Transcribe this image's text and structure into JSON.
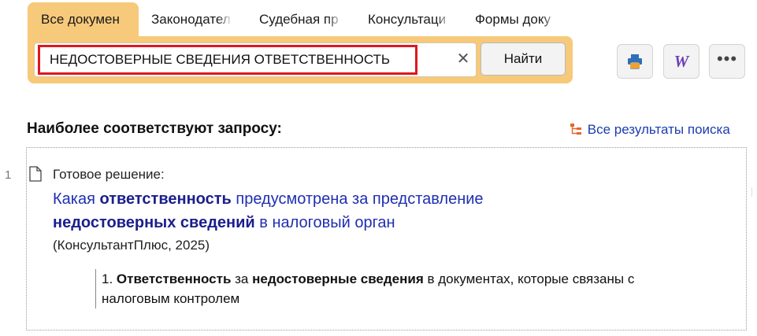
{
  "tabs": [
    {
      "label": "Все докумен",
      "active": true
    },
    {
      "label": "Законодател",
      "active": false
    },
    {
      "label": "Судебная пр",
      "active": false
    },
    {
      "label": "Консультаци",
      "active": false
    },
    {
      "label": "Формы доку",
      "active": false
    }
  ],
  "search": {
    "value": "НЕДОСТОВЕРНЫЕ СВЕДЕНИЯ ОТВЕТСТВЕННОСТЬ",
    "clear_icon": "close-icon",
    "find_label": "Найти"
  },
  "toolbar": {
    "print_icon": "print-icon",
    "word_icon": "word-export-icon",
    "word_glyph": "W",
    "more_icon": "more-icon",
    "more_glyph": "•••"
  },
  "results_header": {
    "title": "Наиболее соответствуют запросу:",
    "all_results_label": "Все результаты поиска"
  },
  "result": {
    "number": "1",
    "type_label": "Готовое решение:",
    "title_parts": [
      {
        "text": "Какая ",
        "bold": false
      },
      {
        "text": "ответственность",
        "bold": true
      },
      {
        "text": " предусмотрена за представление ",
        "bold": false
      },
      {
        "text": "недостоверных сведений",
        "bold": true
      },
      {
        "text": " в налоговый орган",
        "bold": false
      }
    ],
    "source": "(КонсультантПлюс, 2025)",
    "snippet_parts": [
      {
        "text": "1. ",
        "bold": false
      },
      {
        "text": "Ответственность",
        "bold": true
      },
      {
        "text": " за ",
        "bold": false
      },
      {
        "text": "недостоверные сведения",
        "bold": true
      },
      {
        "text": " в документах, которые связаны с налоговым контролем",
        "bold": false
      }
    ]
  },
  "colors": {
    "accent": "#f7c97a",
    "highlight_border": "#e0161f",
    "link": "#1f2fb0"
  }
}
